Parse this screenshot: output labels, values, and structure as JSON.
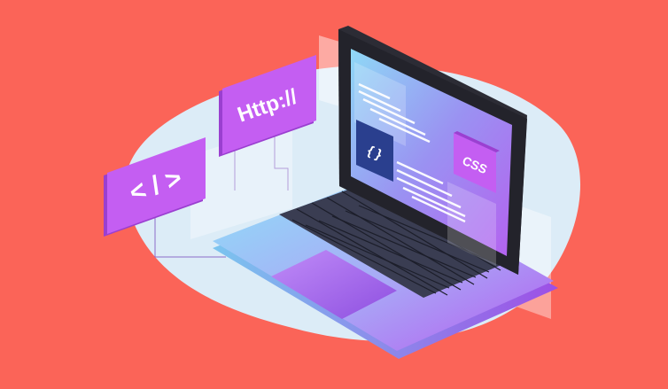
{
  "scene": {
    "background_color": "#fb6458",
    "blob_color": "#dcecf7"
  },
  "cards": {
    "http_label": "Http://",
    "tag_label": "< / >",
    "css_label": "CSS",
    "braces_label": "{ }"
  },
  "icons": [
    "laptop-icon",
    "keyboard-icon",
    "touchpad-icon",
    "code-tag-icon",
    "http-card-icon",
    "css-card-icon",
    "braces-icon"
  ],
  "colors": {
    "card_purple": "#c45ef2",
    "screen_dark": "#2c2c35",
    "body_blue": "#8ad3f5",
    "body_violet": "#b47cf0",
    "braces_bg": "#2a3f8e"
  }
}
